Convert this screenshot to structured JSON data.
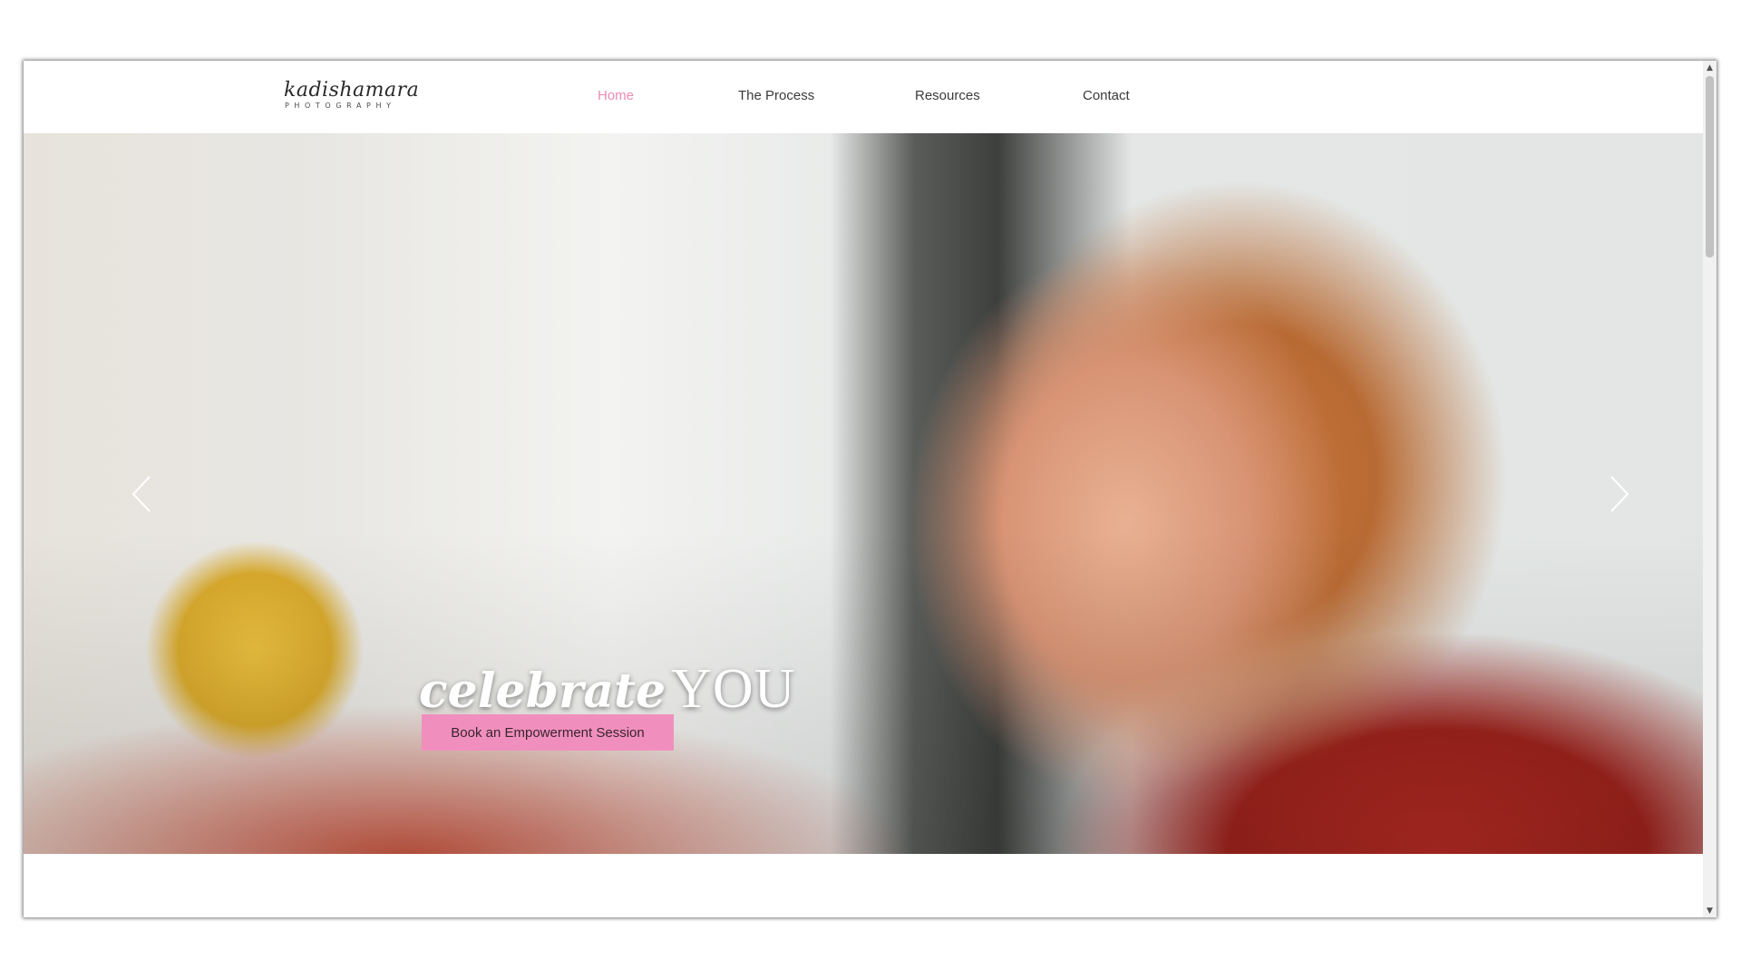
{
  "header": {
    "logo": {
      "name": "kadishamara",
      "subtitle": "PHOTOGRAPHY"
    },
    "nav": [
      {
        "label": "Home",
        "active": true
      },
      {
        "label": "The Process",
        "active": false
      },
      {
        "label": "Resources",
        "active": false
      },
      {
        "label": "Contact",
        "active": false
      }
    ],
    "active_color": "#ec8bb5"
  },
  "hero": {
    "headline_script": "celebrate",
    "headline_caps": "YOU",
    "cta_label": "Book an Empowerment Session",
    "cta_color": "#f08fbd",
    "slide_count": 5,
    "active_slide": 1,
    "prev_icon": "chevron-left-icon",
    "next_icon": "chevron-right-icon"
  },
  "scrollbar": {
    "up_icon": "scroll-up-arrow-icon",
    "down_icon": "scroll-down-arrow-icon"
  }
}
